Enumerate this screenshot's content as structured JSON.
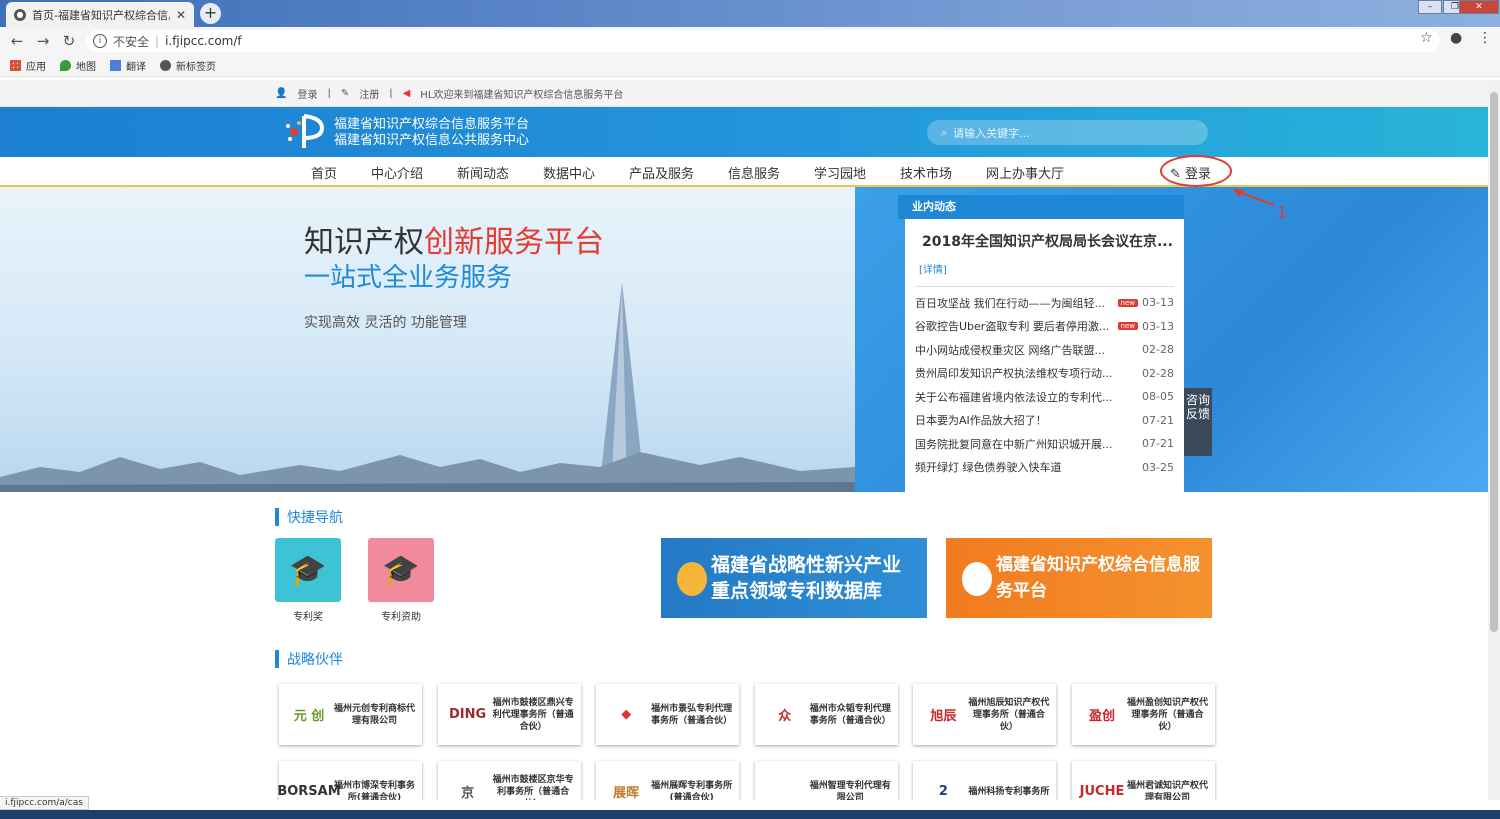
{
  "browser": {
    "tab_title": "首页-福建省知识产权综合信息服",
    "url_security": "不安全",
    "url": "i.fjipcc.com/f",
    "bookmarks": [
      "应用",
      "地图",
      "翻译",
      "新标签页"
    ],
    "status_url": "i.fjipcc.com/a/cas"
  },
  "topbar": {
    "login": "登录",
    "register": "注册",
    "welcome": "HL欢迎来到福建省知识产权综合信息服务平台"
  },
  "header": {
    "site_name_1": "福建省知识产权综合信息服务平台",
    "site_name_2": "福建省知识产权信息公共服务中心",
    "search_placeholder": "请输入关键字..."
  },
  "nav": {
    "items": [
      "首页",
      "中心介绍",
      "新闻动态",
      "数据中心",
      "产品及服务",
      "信息服务",
      "学习园地",
      "技术市场",
      "网上办事大厅"
    ],
    "login": "登录"
  },
  "annotation": {
    "number": "1"
  },
  "hero": {
    "title_black": "知识产权",
    "title_red": "创新服务平台",
    "subtitle": "一站式全业务服务",
    "tagline": "实现高效  灵活的  功能管理"
  },
  "news": {
    "header": "业内动态",
    "headline": "2018年全国知识产权局局长会议在京...",
    "more": "[详情]",
    "badge": "new",
    "items": [
      {
        "title": "百日攻坚战 我们在行动——为闽组轻...",
        "date": "03-13",
        "new": true
      },
      {
        "title": "谷歌控告Uber盗取专利 要后者停用激...",
        "date": "03-13",
        "new": true
      },
      {
        "title": "中小网站成侵权重灾区 网络广告联盟...",
        "date": "02-28",
        "new": false
      },
      {
        "title": "贵州局印发知识产权执法维权专项行动...",
        "date": "02-28",
        "new": false
      },
      {
        "title": "关于公布福建省境内依法设立的专利代...",
        "date": "08-05",
        "new": false
      },
      {
        "title": "日本要为AI作品放大招了！",
        "date": "07-21",
        "new": false
      },
      {
        "title": "国务院批复同意在中新广州知识城开展...",
        "date": "07-21",
        "new": false
      },
      {
        "title": "频开绿灯 绿色债券驶入快车道",
        "date": "03-25",
        "new": false
      }
    ]
  },
  "feedback": "咨询反馈",
  "quicknav": {
    "title": "快捷导航",
    "items": [
      "专利奖",
      "专利资助"
    ],
    "promo_1": "福建省战略性新兴产业重点领域专利数据库",
    "promo_2": "福建省知识产权综合信息服务平台"
  },
  "partners": {
    "title": "战略伙伴",
    "items": [
      {
        "logo": "元 创",
        "name": "福州元创专利商标代理有限公司"
      },
      {
        "logo": "DING",
        "name": "福州市鼓楼区鼎兴专利代理事务所（普通合伙）"
      },
      {
        "logo": "◆",
        "name": "福州市景弘专利代理事务所（普通合伙）"
      },
      {
        "logo": "众",
        "name": "福州市众韬专利代理事务所（普通合伙）"
      },
      {
        "logo": "旭辰",
        "name": "福州旭辰知识产权代理事务所（普通合伙）"
      },
      {
        "logo": "盈创",
        "name": "福州盈创知识产权代理事务所（普通合伙）"
      },
      {
        "logo": "BORSAM",
        "name": "福州市博深专利事务所(普通合伙)"
      },
      {
        "logo": "京",
        "name": "福州市鼓楼区京华专利事务所（普通合伙）"
      },
      {
        "logo": "展晖",
        "name": "福州展晖专利事务所(普通合伙)"
      },
      {
        "logo": "",
        "name": "福州智理专利代理有限公司"
      },
      {
        "logo": "2",
        "name": "福州科扬专利事务所"
      },
      {
        "logo": "JUCHE",
        "name": "福州君诚知识产权代理有限公司"
      }
    ]
  },
  "colors": {
    "brand_blue": "#1e88d6",
    "accent_red": "#e33b2f",
    "nav_underline": "#e8c94a"
  }
}
